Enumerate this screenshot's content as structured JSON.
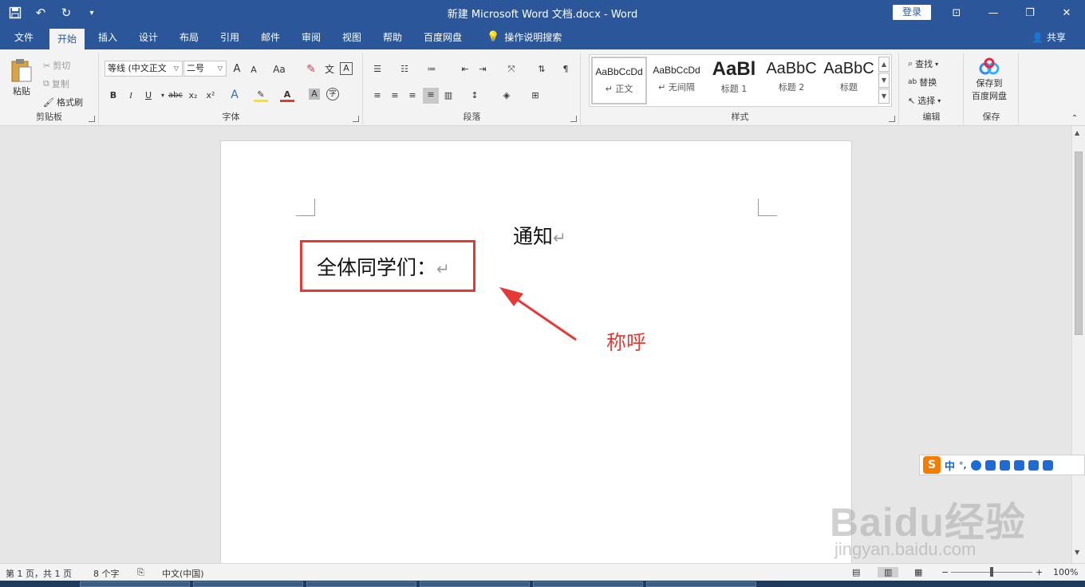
{
  "window": {
    "title": "新建 Microsoft Word 文档.docx  -  Word",
    "login_label": "登录",
    "controls": [
      "⊡",
      "—",
      "❐",
      "✕"
    ]
  },
  "qat": {
    "save_icon": "save-icon",
    "undo_icon": "undo-icon",
    "redo_icon": "redo-icon",
    "customize_icon": "customize-qat-icon"
  },
  "tabs": [
    "文件",
    "开始",
    "插入",
    "设计",
    "布局",
    "引用",
    "邮件",
    "审阅",
    "视图",
    "帮助",
    "百度网盘",
    "操作说明搜索"
  ],
  "active_tab": "开始",
  "share_label": "共享",
  "ribbon": {
    "clipboard": {
      "label": "剪贴板",
      "paste": "粘贴",
      "cut": "剪切",
      "copy": "复制",
      "format_painter": "格式刷"
    },
    "font": {
      "label": "字体",
      "font_name": "等线 (中文正文",
      "font_size": "二号",
      "grow": "A",
      "shrink": "A",
      "case": "Aa",
      "bold": "B",
      "italic": "I",
      "underline": "U",
      "strike": "abc",
      "sub": "x₂",
      "sup": "x²"
    },
    "paragraph": {
      "label": "段落"
    },
    "styles": {
      "label": "样式",
      "items": [
        {
          "preview": "AaBbCcDd",
          "name": "↵ 正文"
        },
        {
          "preview": "AaBbCcDd",
          "name": "↵ 无间隔"
        },
        {
          "preview": "AaBl",
          "name": "标题 1"
        },
        {
          "preview": "AaBbC",
          "name": "标题 2"
        },
        {
          "preview": "AaBbC",
          "name": "标题"
        }
      ]
    },
    "editing": {
      "label": "编辑",
      "find": "查找",
      "replace": "替换",
      "select": "选择"
    },
    "save": {
      "label": "保存",
      "button_line1": "保存到",
      "button_line2": "百度网盘"
    }
  },
  "document": {
    "title": "通知",
    "greeting": "全体同学们：",
    "paragraph_mark": "↵"
  },
  "annotation": {
    "text": "称呼",
    "color": "#e53935"
  },
  "ime": {
    "logo": "S",
    "mode": "中",
    "punct": "°,"
  },
  "watermark": {
    "line1": "Baidu经验",
    "line2": "jingyan.baidu.com"
  },
  "status": {
    "page": "第 1 页，共 1 页",
    "words": "8 个字",
    "language": "中文(中国)",
    "zoom": "100%"
  },
  "colors": {
    "brand": "#2b579a",
    "accent_red": "#e53935"
  }
}
